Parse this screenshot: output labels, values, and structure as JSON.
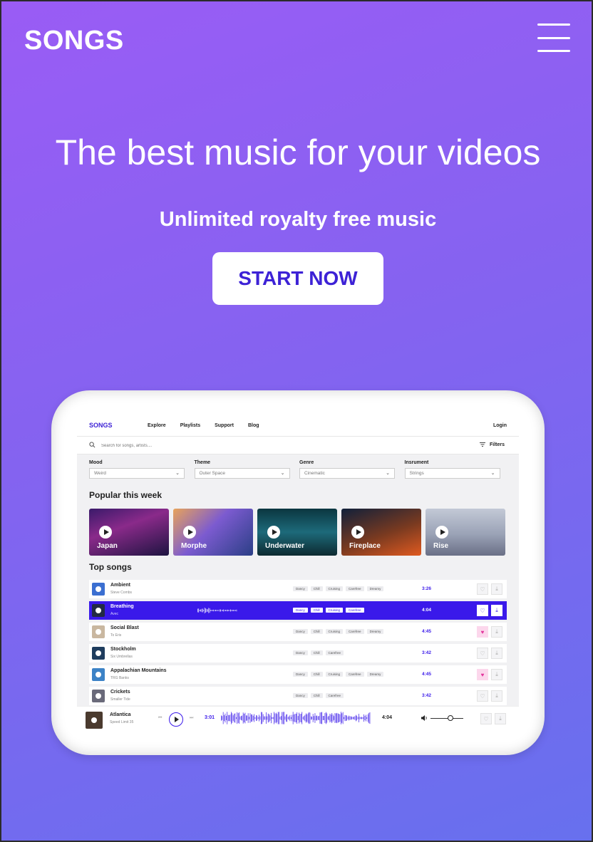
{
  "header": {
    "logo": "SONGS",
    "menu_icon": "hamburger-menu-icon"
  },
  "hero": {
    "title": "The best music for your videos",
    "subtitle": "Unlimited royalty free music",
    "cta_label": "START NOW"
  },
  "app": {
    "logo": "SONGS",
    "nav": [
      "Explore",
      "Playlists",
      "Support",
      "Blog"
    ],
    "login": "Login",
    "search_placeholder": "Search for songs, artists....",
    "filters_label": "Filters",
    "dropdowns": [
      {
        "label": "Mood",
        "value": "Weird"
      },
      {
        "label": "Theme",
        "value": "Outer Space"
      },
      {
        "label": "Genre",
        "value": "Cinematic"
      },
      {
        "label": "Insrument",
        "value": "Strings"
      }
    ],
    "popular_heading": "Popular this week",
    "popular": [
      {
        "name": "Japan",
        "bg": "linear-gradient(160deg,#3a1a6a,#8a2a8a 40%,#1d1440)"
      },
      {
        "name": "Morphe",
        "bg": "linear-gradient(135deg,#e8a35a,#7c5bd0 45%,#2b3f86)"
      },
      {
        "name": "Underwater",
        "bg": "linear-gradient(180deg,#0b3640,#1d6a7a 50%,#0d2a30)"
      },
      {
        "name": "Fireplace",
        "bg": "linear-gradient(160deg,#11203a,#7a3a20 55%,#e05a20)"
      },
      {
        "name": "Rise",
        "bg": "linear-gradient(180deg,#c3c9d6,#9aa2b6 55%,#6a6f86)"
      }
    ],
    "top_heading": "Top songs",
    "songs": [
      {
        "title": "Ambient",
        "artist": "Steve Combs",
        "tags": [
          "Dancy",
          "Chill",
          "Cruising",
          "Carefree",
          "Dreamy"
        ],
        "duration": "3:26",
        "favorite": false,
        "active": false,
        "thumb": "#3b6fd1"
      },
      {
        "title": "Breathing",
        "artist": "Avec",
        "tags": [
          "Dancy",
          "Chill",
          "Cruising",
          "Carefree"
        ],
        "duration": "4:04",
        "favorite": false,
        "active": true,
        "thumb": "#222a44"
      },
      {
        "title": "Social Blast",
        "artist": "To Eris",
        "tags": [
          "Dancy",
          "Chill",
          "Cruising",
          "Carefree",
          "Dreamy"
        ],
        "duration": "4:45",
        "favorite": true,
        "active": false,
        "thumb": "#c9b7a0"
      },
      {
        "title": "Stockholm",
        "artist": "Six Umbrellas",
        "tags": [
          "Dancy",
          "Chill",
          "Carefree"
        ],
        "duration": "3:42",
        "favorite": false,
        "active": false,
        "thumb": "#1f3d5e"
      },
      {
        "title": "Appalachian Mountains",
        "artist": "TRG Banks",
        "tags": [
          "Dancy",
          "Chill",
          "Cruising",
          "Carefree",
          "Dreamy"
        ],
        "duration": "4:45",
        "favorite": true,
        "active": false,
        "thumb": "#3c82c6"
      },
      {
        "title": "Crickets",
        "artist": "Smaller Tide",
        "tags": [
          "Dancy",
          "Chill",
          "Carefree"
        ],
        "duration": "3:42",
        "favorite": false,
        "active": false,
        "thumb": "#6a6a7a"
      }
    ],
    "player": {
      "title": "Atlantica",
      "artist": "Speed Limit 35",
      "current": "3:01",
      "total": "4:04",
      "volume": 0.6
    }
  },
  "colors": {
    "accent": "#3a19ea",
    "favorite": "#e2349b",
    "bg_top": "#9a5cf5",
    "bg_bottom": "#6770ee"
  }
}
